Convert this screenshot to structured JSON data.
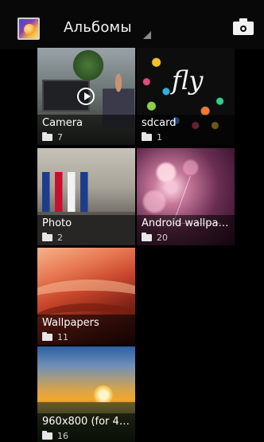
{
  "action_bar": {
    "title": "Альбомы",
    "app_icon": "gallery-icon",
    "camera_icon": "camera-icon"
  },
  "albums": [
    {
      "title": "Camera",
      "count": "7",
      "has_video": true
    },
    {
      "title": "sdcard",
      "count": "1",
      "logo_text": "fly"
    },
    {
      "title": "Photo",
      "count": "2"
    },
    {
      "title": "Android wallpap...",
      "count": "20"
    },
    {
      "title": "Wallpapers",
      "count": "11"
    },
    {
      "title": "960x800 (for 48...",
      "count": "16"
    }
  ]
}
